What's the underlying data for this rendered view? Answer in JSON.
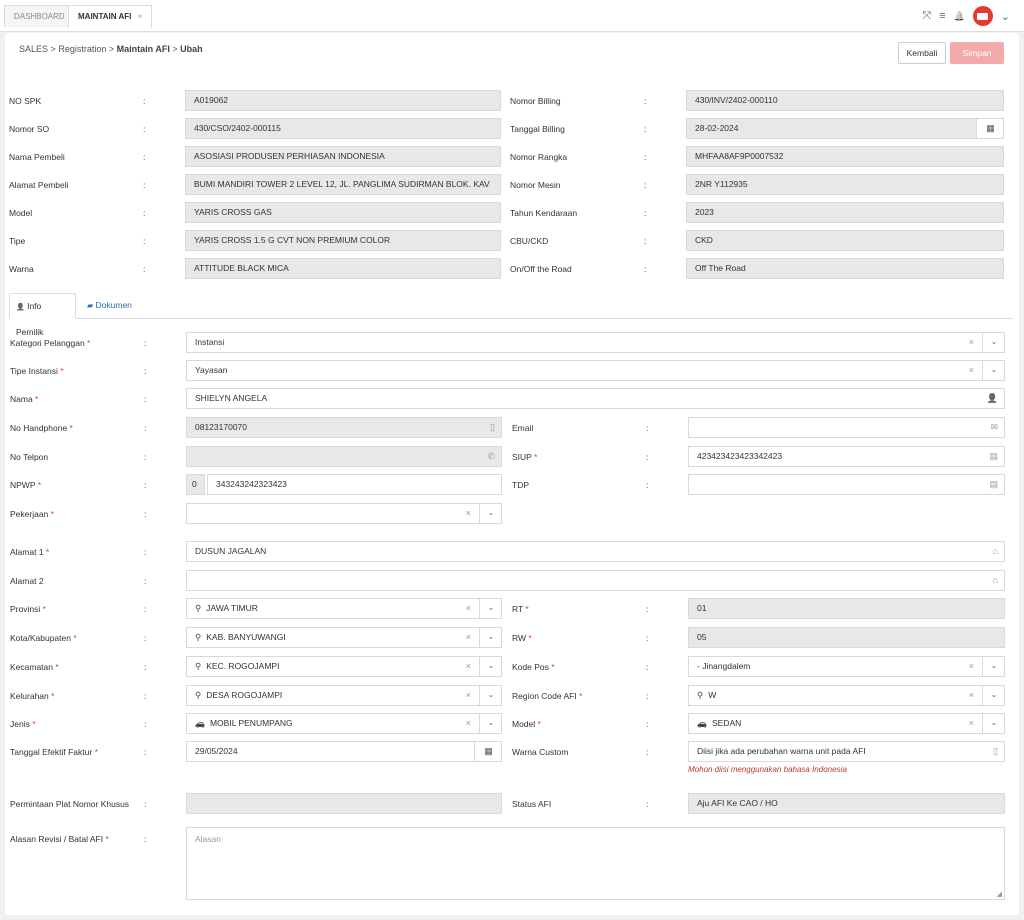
{
  "tabs": [
    {
      "label": "DASHBOARD"
    },
    {
      "label": "MAINTAIN AFI",
      "close": "×"
    }
  ],
  "breadcrumb": {
    "root": "SALES",
    "level1": "Registration",
    "level2": "Maintain AFI",
    "level3": "Ubah",
    "sep": ">"
  },
  "actions": {
    "back": "Kembali",
    "save": "Simpan"
  },
  "colon": ":",
  "header_left": [
    {
      "label": "NO SPK",
      "value": "A019062"
    },
    {
      "label": "Nomor SO",
      "value": "430/CSO/2402-000115"
    },
    {
      "label": "Nama Pembeli",
      "value": "ASOSIASI PRODUSEN PERHIASAN INDONESIA"
    },
    {
      "label": "Alamat Pembeli",
      "value": "BUMI MANDIRI TOWER 2 LEVEL 12, JL. PANGLIMA SUDIRMAN BLOK. KAV"
    },
    {
      "label": "Model",
      "value": "YARIS CROSS GAS"
    },
    {
      "label": "Tipe",
      "value": "YARIS CROSS 1.5 G CVT NON PREMIUM COLOR"
    },
    {
      "label": "Warna",
      "value": "ATTITUDE BLACK MICA"
    }
  ],
  "header_right": [
    {
      "label": "Nomor Billing",
      "value": "430/INV/2402-000110"
    },
    {
      "label": "Tanggal Billing",
      "value": "28-02-2024"
    },
    {
      "label": "Nomor Rangka",
      "value": "MHFAA8AF9P0007532"
    },
    {
      "label": "Nomor Mesin",
      "value": "2NR Y112935"
    },
    {
      "label": "Tahun Kendaraan",
      "value": "2023"
    },
    {
      "label": "CBU/CKD",
      "value": "CKD"
    },
    {
      "label": "On/Off the Road",
      "value": "Off The Road"
    }
  ],
  "detail_tabs": {
    "info": "Info Pemilik",
    "docs": "Dokumen"
  },
  "required_mark": "*",
  "form": {
    "kategori": {
      "label": "Kategori Pelanggan",
      "value": "Instansi"
    },
    "tipe_instansi": {
      "label": "Tipe Instansi",
      "value": "Yayasan"
    },
    "nama": {
      "label": "Nama",
      "value": "SHIELYN ANGELA"
    },
    "handphone": {
      "label": "No Handphone",
      "value": "08123170070"
    },
    "email": {
      "label": "Email",
      "value": ""
    },
    "telpon": {
      "label": "No Telpon",
      "value": ""
    },
    "siup": {
      "label": "SIUP",
      "value": "423423423423342423"
    },
    "npwp": {
      "label": "NPWP",
      "prefix": "0",
      "value": "343243242323423"
    },
    "tdp": {
      "label": "TDP",
      "value": ""
    },
    "pekerjaan": {
      "label": "Pekerjaan",
      "value": ""
    },
    "alamat1": {
      "label": "Alamat 1",
      "value": "DUSUN JAGALAN"
    },
    "alamat2": {
      "label": "Alamat 2",
      "value": ""
    },
    "provinsi": {
      "label": "Provinsi",
      "value": "JAWA TIMUR"
    },
    "rt": {
      "label": "RT",
      "value": "01"
    },
    "kota": {
      "label": "Kota/Kabupaten",
      "value": "KAB. BANYUWANGI"
    },
    "rw": {
      "label": "RW",
      "value": "05"
    },
    "kecamatan": {
      "label": "Kecamatan",
      "value": "KEC. ROGOJAMPI"
    },
    "kodepos": {
      "label": "Kode Pos",
      "value": "- Jinangdalem"
    },
    "kelurahan": {
      "label": "Kelurahan",
      "value": "DESA ROGOJAMPI"
    },
    "region": {
      "label": "Region Code AFI",
      "value": "W"
    },
    "jenis": {
      "label": "Jenis",
      "value": "MOBIL PENUMPANG"
    },
    "model": {
      "label": "Model",
      "value": "SEDAN"
    },
    "tanggal_faktur": {
      "label": "Tanggal Efektif Faktur",
      "value": "29/05/2024"
    },
    "warna_custom": {
      "label": "Warna Custom",
      "placeholder": "Diisi jika ada perubahan warna unit pada AFI",
      "hint": "Mohon diisi menggunakan bahasa Indonesia"
    },
    "plat": {
      "label": "Permintaan Plat Nomor Khusus",
      "value": ""
    },
    "status": {
      "label": "Status AFI",
      "value": "Aju AFI Ke CAO / HO"
    },
    "alasan": {
      "label": "Alasan Revisi / Batal AFI",
      "placeholder": "Alasan"
    }
  },
  "icons": {
    "clear": "×",
    "arrow": "⌄",
    "calendar": "▦",
    "user": "👤",
    "mobile": "▯",
    "envelope": "✉",
    "phone": "✆",
    "idcard": "▤",
    "home": "⌂",
    "pin": "⚲",
    "car": "🚗",
    "expand": "⤧",
    "menu": "≡",
    "bell": "🔔",
    "chevron": "⌄",
    "folder": "▰",
    "resize": "◢"
  }
}
